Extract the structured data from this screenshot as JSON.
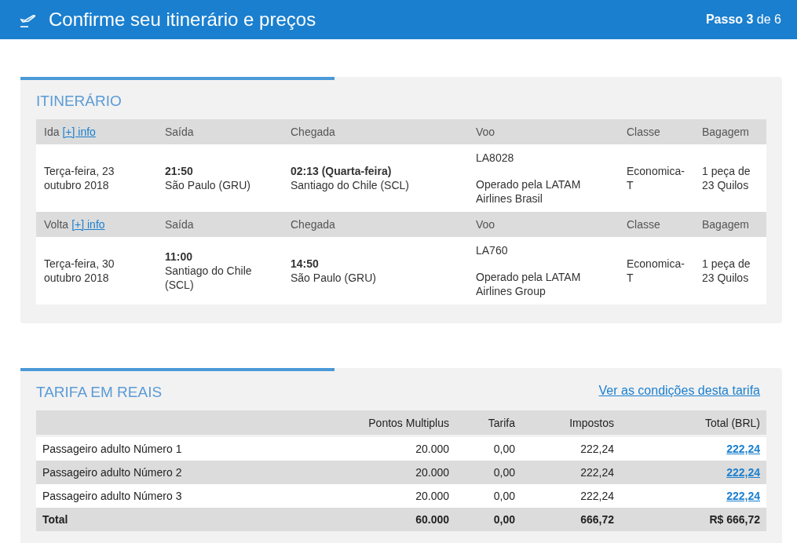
{
  "header": {
    "title": "Confirme seu itinerário e preços",
    "step": "**Passo 3** de 6"
  },
  "itinerary": {
    "title": "ITINERÁRIO",
    "legs": [
      {
        "label": "Ida",
        "info_link": "[+] info",
        "columns": [
          "Saída",
          "Chegada",
          "Voo",
          "Classe",
          "Bagagem"
        ],
        "date": "Terça-feira, 23 outubro 2018",
        "departure": "**21:50** São Paulo (GRU)",
        "arrival": "**02:13 (Quarta-feira)** Santiago do Chile (SCL)",
        "flight": "LA8028",
        "operator": "Operado pela LATAM Airlines Brasil",
        "class": "Economica-T",
        "baggage": "1 peça de 23 Quilos"
      },
      {
        "label": "Volta",
        "info_link": "[+] info",
        "columns": [
          "Saída",
          "Chegada",
          "Voo",
          "Classe",
          "Bagagem"
        ],
        "date": "Terça-feira, 30 outubro 2018",
        "departure": "**11:00** Santiago do Chile (SCL)",
        "arrival": "**14:50** São Paulo (GRU)",
        "flight": "LA760",
        "operator": "Operado pela LATAM Airlines Group",
        "class": "Economica-T",
        "baggage": "1 peça de 23 Quilos"
      }
    ]
  },
  "fare": {
    "title": "TARIFA EM REAIS",
    "conditions_link": "Ver as condições desta tarifa",
    "columns": [
      "Pontos Multiplus",
      "Tarifa",
      "Impostos",
      "Total (BRL)"
    ],
    "rows": [
      {
        "passenger": "Passageiro adulto Número 1",
        "points": "20.000",
        "fare": "0,00",
        "taxes": "222,24",
        "total": "222,24"
      },
      {
        "passenger": "Passageiro adulto Número 2",
        "points": "20.000",
        "fare": "0,00",
        "taxes": "222,24",
        "total": "222,24"
      },
      {
        "passenger": "Passageiro adulto Número 3",
        "points": "20.000",
        "fare": "0,00",
        "taxes": "222,24",
        "total": "222,24"
      }
    ],
    "total": {
      "label": "Total",
      "points": "60.000",
      "fare": "0,00",
      "taxes": "666,72",
      "total": "R$ 666,72"
    }
  }
}
